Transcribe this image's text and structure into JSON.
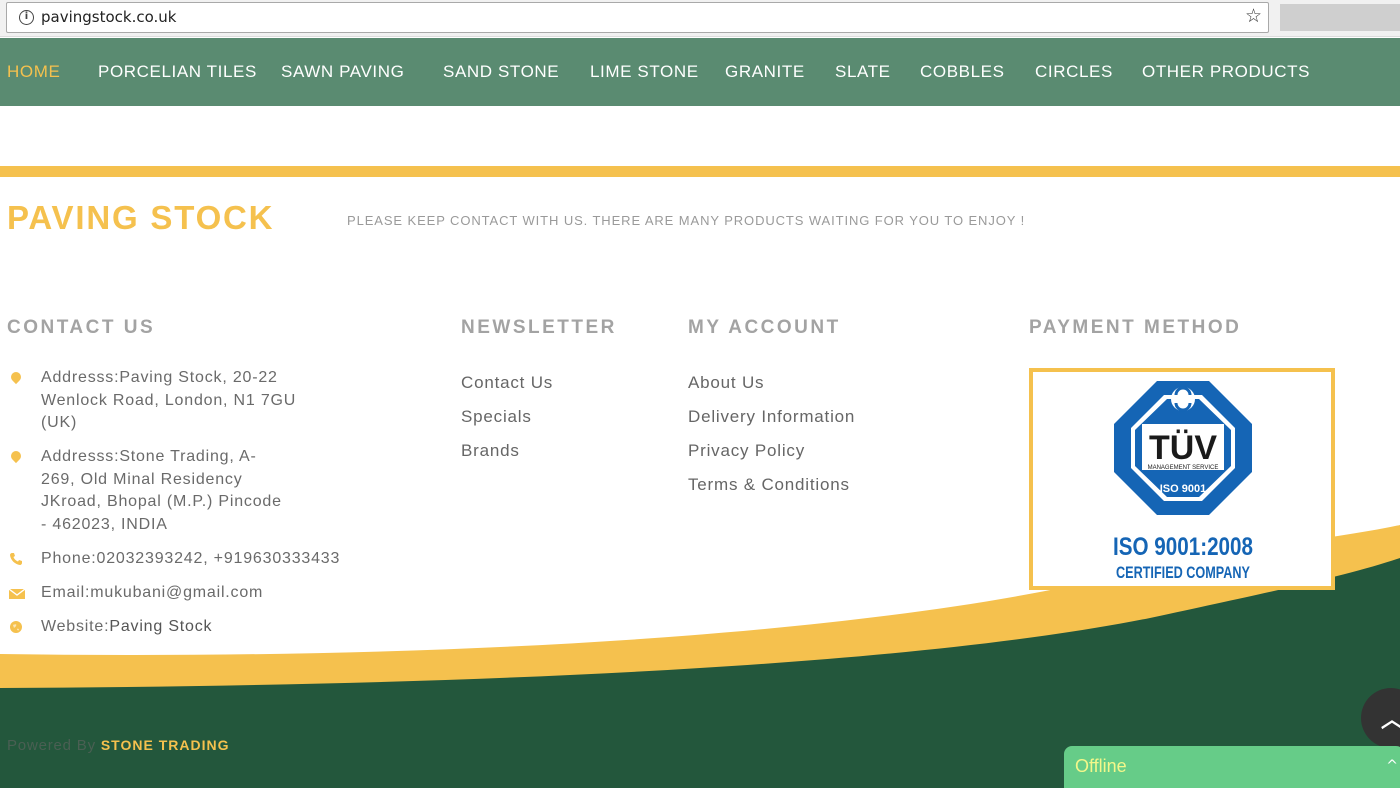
{
  "browser": {
    "url": "pavingstock.co.uk"
  },
  "nav": {
    "items": [
      {
        "label": "HOME",
        "active": true
      },
      {
        "label": "PORCELIAN TILES"
      },
      {
        "label": "SAWN PAVING"
      },
      {
        "label": "SAND STONE"
      },
      {
        "label": "LIME STONE"
      },
      {
        "label": "GRANITE"
      },
      {
        "label": "SLATE"
      },
      {
        "label": "COBBLES"
      },
      {
        "label": "CIRCLES"
      },
      {
        "label": "OTHER PRODUCTS"
      }
    ]
  },
  "footer": {
    "brand": "PAVING STOCK",
    "tagline": "PLEASE KEEP CONTACT WITH US. THERE ARE MANY PRODUCTS WAITING FOR YOU TO ENJOY !",
    "contact": {
      "heading": "CONTACT US",
      "address1": [
        "Addresss:Paving Stock, 20-22",
        "Wenlock Road, London, N1 7GU",
        "(UK)"
      ],
      "address2": [
        "Addresss:Stone Trading, A-",
        "269, Old Minal Residency",
        "JKroad, Bhopal (M.P.) Pincode",
        "- 462023, INDIA"
      ],
      "phone": "Phone:02032393242, +919630333433",
      "email": "Email:mukubani@gmail.com",
      "website_prefix": "Website:",
      "website_link": "Paving Stock"
    },
    "newsletter": {
      "heading": "NEWSLETTER",
      "links": [
        "Contact Us",
        "Specials",
        "Brands"
      ]
    },
    "account": {
      "heading": "MY ACCOUNT",
      "links": [
        "About Us",
        "Delivery Information",
        "Privacy Policy",
        "Terms & Conditions"
      ]
    },
    "payment": {
      "heading": "PAYMENT METHOD",
      "badge": {
        "logo_text": "TÜV",
        "service_text": "MANAGEMENT SERVICE",
        "iso_small": "ISO 9001",
        "iso_line": "ISO 9001:2008",
        "certified": "CERTIFIED COMPANY"
      }
    },
    "powered_by": "Powered By",
    "powered_by_brand": "STONE TRADING"
  },
  "chat": {
    "status": "Offline"
  },
  "colors": {
    "nav_bg": "#5a8b71",
    "accent_yellow": "#f5c14e",
    "footer_dark": "#23573c",
    "tuv_blue": "#1565b5",
    "chat_green": "#66cc88"
  },
  "icons": [
    "info-icon",
    "star-icon",
    "location-pin-icon",
    "phone-icon",
    "envelope-icon",
    "globe-icon",
    "chevron-up-icon",
    "tuv-logo"
  ]
}
